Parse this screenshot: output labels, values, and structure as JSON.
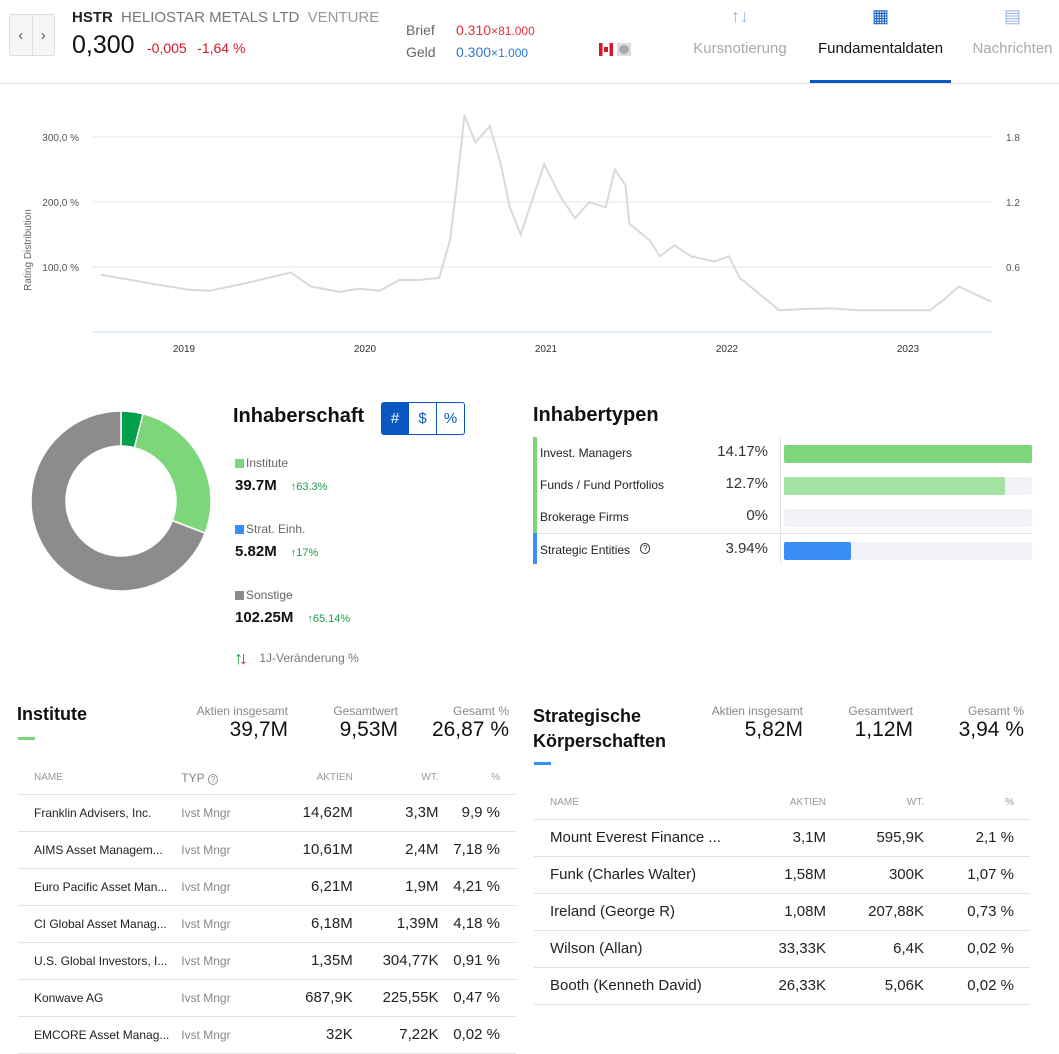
{
  "header": {
    "ticker": "HSTR",
    "company": "HELIOSTAR METALS LTD",
    "exchange": "VENTURE",
    "price": "0,300",
    "change": "-0,005",
    "change_pct": "-1,64 %",
    "ask_label": "Brief",
    "ask": "0.310",
    "ask_size": "81.000",
    "bid_label": "Geld",
    "bid": "0.300",
    "bid_size": "1.000",
    "mult": "×"
  },
  "tabs": [
    {
      "label": "Kursnotierung",
      "icon": "up-down-arrows-icon"
    },
    {
      "label": "Fundamentaldaten",
      "icon": "building-icon",
      "active": true
    },
    {
      "label": "Nachrichten",
      "icon": "newspaper-icon"
    }
  ],
  "chart_data": {
    "type": "line",
    "ylabel": "Rating Distribution",
    "y_left_ticks": [
      "100,0 %",
      "200,0 %",
      "300,0 %"
    ],
    "y_right_ticks": [
      "0.6",
      "1.2",
      "1.8"
    ],
    "ylim_right": [
      0,
      2.1
    ],
    "x_ticks": [
      "2019",
      "2020",
      "2021",
      "2022",
      "2023"
    ],
    "grid": true,
    "color": "#d9d9d9",
    "x": [
      2018.54,
      2018.81,
      2019.03,
      2019.14,
      2019.34,
      2019.59,
      2019.7,
      2019.86,
      2019.97,
      2020.08,
      2020.19,
      2020.3,
      2020.41,
      2020.47,
      2020.51,
      2020.55,
      2020.61,
      2020.69,
      2020.75,
      2020.8,
      2020.86,
      2020.91,
      2020.99,
      2021.08,
      2021.16,
      2021.24,
      2021.33,
      2021.38,
      2021.44,
      2021.46,
      2021.57,
      2021.63,
      2021.71,
      2021.8,
      2021.93,
      2022.01,
      2022.07,
      2022.18,
      2022.29,
      2022.4,
      2022.57,
      2022.73,
      2022.96,
      2023.12,
      2023.2,
      2023.28,
      2023.37,
      2023.46
    ],
    "y": [
      0.53,
      0.45,
      0.39,
      0.38,
      0.45,
      0.55,
      0.42,
      0.37,
      0.4,
      0.38,
      0.48,
      0.48,
      0.5,
      0.85,
      1.4,
      2.0,
      1.75,
      1.9,
      1.55,
      1.15,
      0.9,
      1.15,
      1.55,
      1.25,
      1.05,
      1.2,
      1.15,
      1.5,
      1.35,
      1.0,
      0.85,
      0.7,
      0.8,
      0.7,
      0.65,
      0.7,
      0.5,
      0.35,
      0.2,
      0.21,
      0.22,
      0.2,
      0.2,
      0.2,
      0.3,
      0.42,
      0.35,
      0.28
    ]
  },
  "ownership": {
    "title": "Inhaberschaft",
    "toggle": [
      "#",
      "$",
      "%"
    ],
    "active_toggle": "#",
    "donut": [
      {
        "value": 3.94,
        "color": "#00a04a"
      },
      {
        "value": 26.87,
        "color": "#7dd67a"
      },
      {
        "value": 69.19,
        "color": "#8c8c8c"
      }
    ],
    "legend": [
      {
        "label": "Institute",
        "value": "39.7M",
        "change": "63.3%",
        "color": "#7dd67a"
      },
      {
        "label": "Strat. Einh.",
        "value": "5.82M",
        "change": "17%",
        "color": "#3a8ff7"
      },
      {
        "label": "Sonstige",
        "value": "102.25M",
        "change": "65.14%",
        "color": "#8c8c8c"
      }
    ],
    "change_note": "1J-Veränderung %"
  },
  "holder_types": {
    "title": "Inhabertypen",
    "rows": [
      {
        "label": "Invest. Managers",
        "pct": "14.17%",
        "fill": 1.0,
        "color": "#7dd67a"
      },
      {
        "label": "Funds / Fund Portfolios",
        "pct": "12.7%",
        "fill": 0.89,
        "color": "#a3e2a0"
      },
      {
        "label": "Brokerage Firms",
        "pct": "0%",
        "fill": 0,
        "color": "#a3e2a0"
      },
      {
        "label": "Strategic Entities",
        "pct": "3.94%",
        "fill": 0.27,
        "color": "#3a8ff7"
      }
    ]
  },
  "institutes": {
    "title": "Institute",
    "stats": [
      {
        "label": "Aktien insgesamt",
        "value": "39,7M"
      },
      {
        "label": "Gesamtwert",
        "value": "9,53M"
      },
      {
        "label": "Gesamt %",
        "value": "26,87 %"
      }
    ],
    "columns": [
      "NAME",
      "TYP",
      "AKTIEN",
      "WT.",
      "%"
    ],
    "rows": [
      [
        "Franklin Advisers, Inc.",
        "Ivst Mngr",
        "14,62M",
        "3,3M",
        "9,9 %"
      ],
      [
        "AIMS Asset Managem...",
        "Ivst Mngr",
        "10,61M",
        "2,4M",
        "7,18 %"
      ],
      [
        "Euro Pacific Asset Man...",
        "Ivst Mngr",
        "6,21M",
        "1,9M",
        "4,21 %"
      ],
      [
        "CI Global Asset Manag...",
        "Ivst Mngr",
        "6,18M",
        "1,39M",
        "4,18 %"
      ],
      [
        "U.S. Global Investors, I...",
        "Ivst Mngr",
        "1,35M",
        "304,77K",
        "0,91 %"
      ],
      [
        "Konwave AG",
        "Ivst Mngr",
        "687,9K",
        "225,55K",
        "0,47 %"
      ],
      [
        "EMCORE Asset Manag...",
        "Ivst Mngr",
        "32K",
        "7,22K",
        "0,02 %"
      ]
    ]
  },
  "strategic": {
    "title1": "Strategische",
    "title2": "Körperschaften",
    "stats": [
      {
        "label": "Aktien insgesamt",
        "value": "5,82M"
      },
      {
        "label": "Gesamtwert",
        "value": "1,12M"
      },
      {
        "label": "Gesamt %",
        "value": "3,94 %"
      }
    ],
    "columns": [
      "NAME",
      "AKTIEN",
      "WT.",
      "%"
    ],
    "rows": [
      [
        "Mount Everest Finance ...",
        "3,1M",
        "595,9K",
        "2,1 %"
      ],
      [
        "Funk (Charles Walter)",
        "1,58M",
        "300K",
        "1,07 %"
      ],
      [
        "Ireland (George R)",
        "1,08M",
        "207,88K",
        "0,73 %"
      ],
      [
        "Wilson (Allan)",
        "33,33K",
        "6,4K",
        "0,02 %"
      ],
      [
        "Booth (Kenneth David)",
        "26,33K",
        "5,06K",
        "0,02 %"
      ]
    ]
  }
}
